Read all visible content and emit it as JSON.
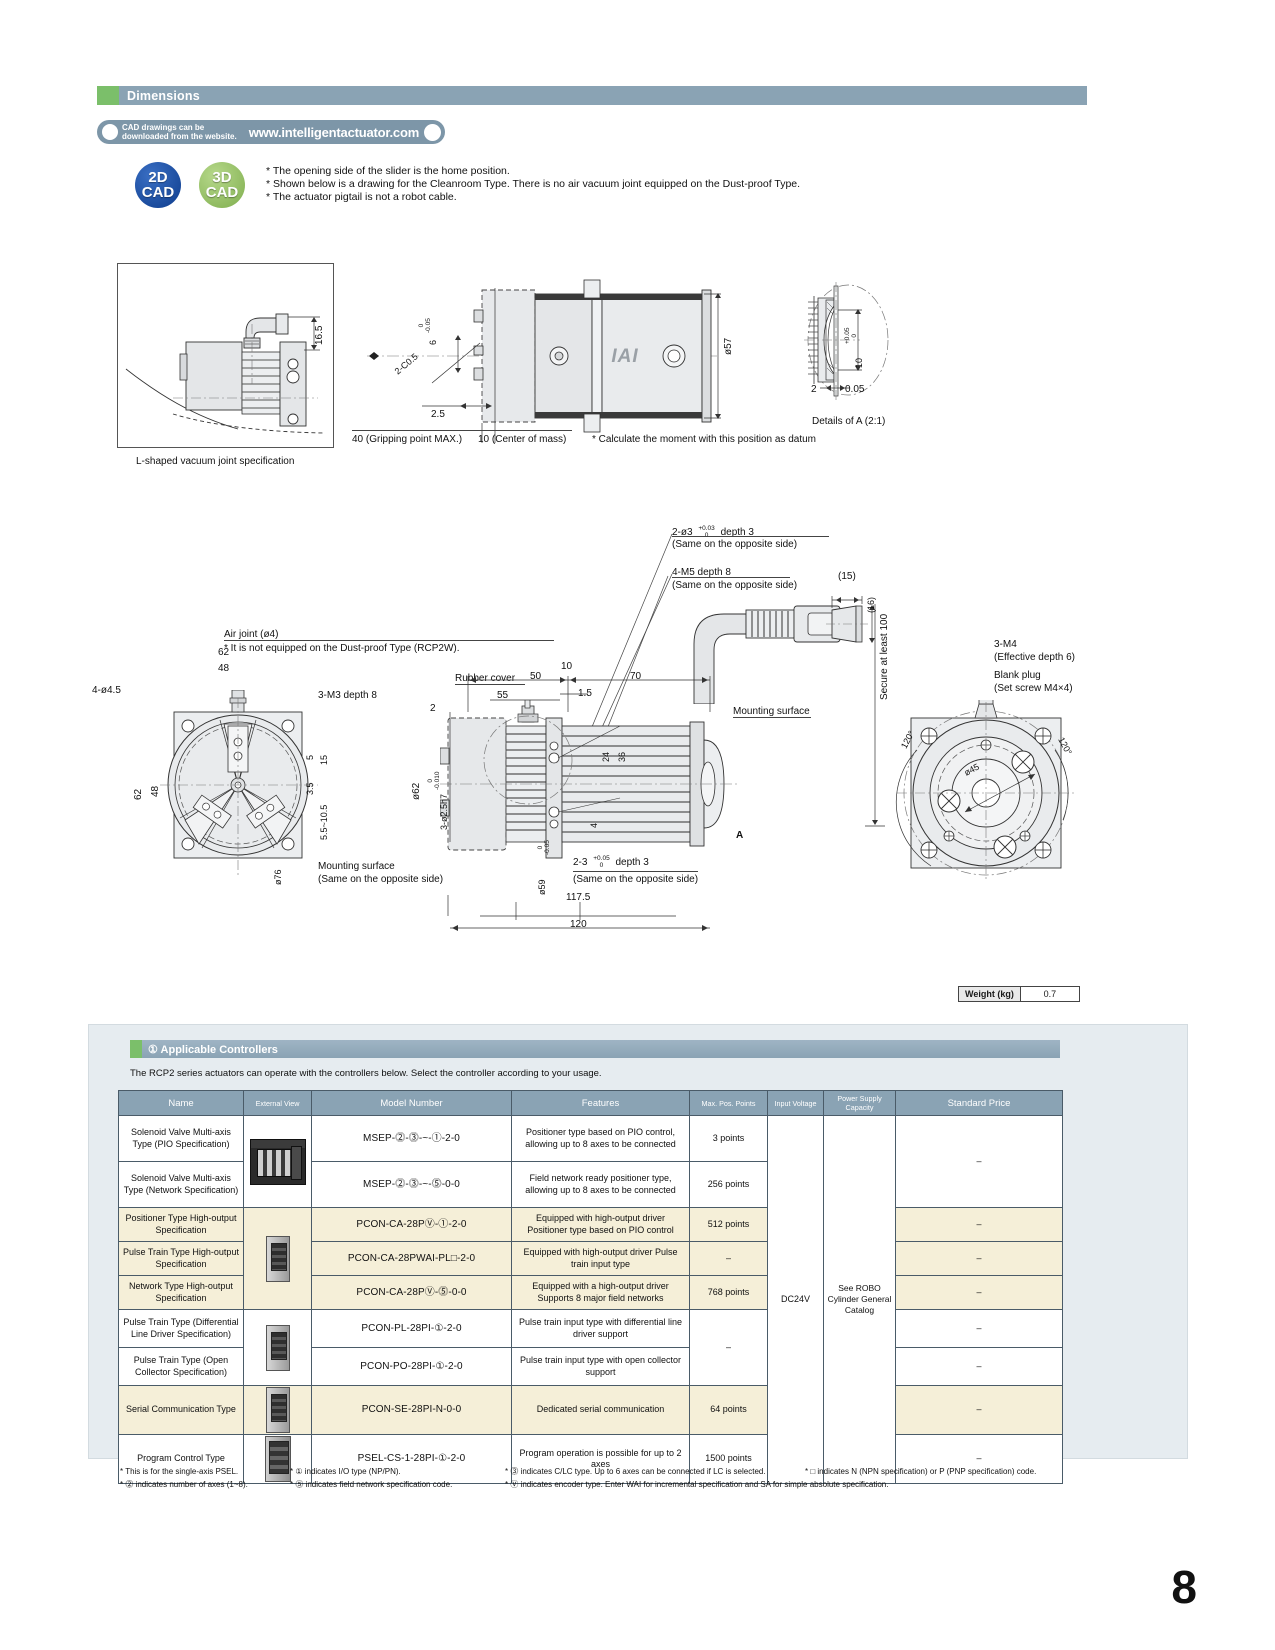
{
  "section": {
    "title": "Dimensions"
  },
  "cad": {
    "note_line1": "CAD drawings can be",
    "note_line2": "downloaded from the website.",
    "url": "www.intelligentactuator.com",
    "badge_2d_top": "2D",
    "badge_2d_bottom": "CAD",
    "badge_3d_top": "3D",
    "badge_3d_bottom": "CAD"
  },
  "notes": [
    "* The opening side of the slider is the home position.",
    "* Shown below is a drawing for the Cleanroom Type. There is no air vacuum joint equipped on the Dust-proof Type.",
    "* The actuator pigtail is not a robot cable."
  ],
  "drawing_top": {
    "panel_caption": "L-shaped vacuum joint specification",
    "dim_165": "16.5",
    "dim_6": "6",
    "tol_6_upper": "0",
    "tol_6_lower": "-0.05",
    "dim_2_c05": "2-C0.5",
    "dim_25": "2.5",
    "dim_o57": "ø57",
    "label_gripping": "40 (Gripping point MAX.)",
    "label_center_mass": "10 (Center of mass)",
    "label_moment": "* Calculate the moment with this position as datum",
    "brand": "IAI",
    "detail_caption": "Details of A (2:1)",
    "detail_dim_10": "10",
    "detail_tol_upper": "+0.05",
    "detail_tol_lower": "0",
    "detail_dim_2": "2",
    "detail_dim_005": "0.05"
  },
  "drawing_main": {
    "air_joint": "Air joint (ø4)",
    "air_joint_note": "* It is not equipped on the Dust-proof Type (RCP2W).",
    "hole_2o3": "2-ø3",
    "hole_2o3_tol_up": "+0.03",
    "hole_2o3_tol_lo": "0",
    "hole_2o3_depth": "depth 3",
    "same_opposite": "(Same on the opposite side)",
    "hole_4m5": "4-M5 depth 8",
    "dim_15_paren": "(15)",
    "dim_16_paren": "(16)",
    "secure": "Secure at least 100",
    "m4_label": "3-M4",
    "m4_depth": "(Effective depth 6)",
    "blank_plug": "Blank plug",
    "set_screw": "(Set screw M4×4)",
    "angle_120_left": "120°",
    "angle_120_right": "120°",
    "dim_o45": "ø45",
    "left_62_top": "62",
    "left_48_top": "48",
    "left_4_o45": "4-ø4.5",
    "left_3m3": "3-M3 depth 8",
    "left_62_side": "62",
    "left_48_side": "48",
    "left_15": "15",
    "left_5": "5",
    "left_35": "3.5",
    "left_55_105": "5.5~10.5",
    "left_o76": "ø76",
    "left_mounting": "Mounting surface",
    "left_mounting_note": "(Same on the opposite side)",
    "rubber_cover": "Rubber cover",
    "dim_50": "50",
    "dim_70": "70",
    "dim_55": "55",
    "dim_10": "10",
    "dim_15": "1.5",
    "dim_2": "2",
    "dim_o62": "ø62",
    "dim_3_o25h7": "3-ø2.5h7",
    "tol_h7_up": "0",
    "tol_h7_lo": "-0.010",
    "dim_24": "24",
    "dim_36": "36",
    "dim_4": "4",
    "tol_0": "0",
    "tol_005": "-0.05",
    "hole_2_3": "2-3",
    "hole_2_3_tol_up": "+0.05",
    "hole_2_3_tol_lo": "0",
    "hole_2_3_depth": "depth 3",
    "dim_o59": "ø59",
    "dim_1175": "117.5",
    "dim_120": "120",
    "mounting_surface": "Mounting surface",
    "marker_a": "A"
  },
  "weight": {
    "label": "Weight (kg)",
    "value": "0.7"
  },
  "controllers": {
    "number": "①",
    "title": "Applicable Controllers",
    "subtitle": "The RCP2 series actuators can operate with the controllers below. Select the controller according to your usage.",
    "columns": [
      "Name",
      "External View",
      "Model Number",
      "Features",
      "Max. Pos. Points",
      "Input Voltage",
      "Power Supply Capacity",
      "Standard Price"
    ],
    "input_voltage": "DC24V",
    "power_supply": "See ROBO Cylinder General Catalog",
    "rows": [
      {
        "name": "Solenoid Valve Multi-axis Type (PIO Specification)",
        "thumb": "msep-thumb",
        "model": "MSEP-⓶-⓷-~-①-2-0",
        "features": "Positioner type based on PIO control, allowing up to 8 axes to be connected",
        "max_points": "3 points",
        "price": "–",
        "highlight": false
      },
      {
        "name": "Solenoid Valve Multi-axis Type (Network Specification)",
        "thumb": "msep-thumb",
        "model": "MSEP-⓶-⓷-~-⓹-0-0",
        "features": "Field network ready positioner type, allowing up to 8 axes to be connected",
        "max_points": "256 points",
        "price": "–",
        "highlight": false
      },
      {
        "name": "Positioner Type High-output Specification",
        "thumb": "pcon-thumb",
        "model": "PCON-CA-28PⓋ-①-2-0",
        "features": "Equipped with high-output driver Positioner type based on PIO control",
        "max_points": "512 points",
        "price": "–",
        "highlight": true
      },
      {
        "name": "Pulse Train Type High-output Specification",
        "thumb": "pcon-thumb",
        "model": "PCON-CA-28PWAI-PL□-2-0",
        "features": "Equipped with high-output driver Pulse train input type",
        "max_points": "–",
        "price": "–",
        "highlight": true
      },
      {
        "name": "Network Type High-output Specification",
        "thumb": "pcon-thumb",
        "model": "PCON-CA-28PⓋ-⓹-0-0",
        "features": "Equipped with a high-output driver Supports 8 major field networks",
        "max_points": "768 points",
        "price": "–",
        "highlight": true
      },
      {
        "name": "Pulse Train Type (Differential Line Driver Specification)",
        "thumb": "pcon-thumb",
        "model": "PCON-PL-28PI-①-2-0",
        "features": "Pulse train input type with differential line driver support",
        "max_points": "–",
        "price": "–",
        "highlight": false
      },
      {
        "name": "Pulse Train Type (Open Collector Specification)",
        "thumb": "pcon-thumb",
        "model": "PCON-PO-28PI-①-2-0",
        "features": "Pulse train input type with open collector support",
        "max_points": "",
        "price": "–",
        "highlight": false
      },
      {
        "name": "Serial Communication Type",
        "thumb": "pcon-thumb",
        "model": "PCON-SE-28PI-N-0-0",
        "features": "Dedicated serial communication",
        "max_points": "64 points",
        "price": "–",
        "highlight": true
      },
      {
        "name": "Program Control Type",
        "thumb": "psel-thumb",
        "model": "PSEL-CS-1-28PI-①-2-0",
        "features": "Program operation is possible for up to 2 axes",
        "max_points": "1500 points",
        "price": "–",
        "highlight": false
      }
    ],
    "footnotes": [
      "* This is for the single-axis PSEL.",
      "* ① indicates I/O type (NP/PN).",
      "* ⓷ indicates C/LC type. Up to 6 axes can be connected if LC is selected.",
      "* □ indicates N (NPN specification) or P (PNP specification) code.",
      "* ⓶ indicates number of axes (1~8).",
      "* ⓹ indicates field network specification code.",
      "* Ⓥ indicates encoder type. Enter WAI for incremental specification and SA for simple absolute specification."
    ]
  },
  "page_number": "8"
}
